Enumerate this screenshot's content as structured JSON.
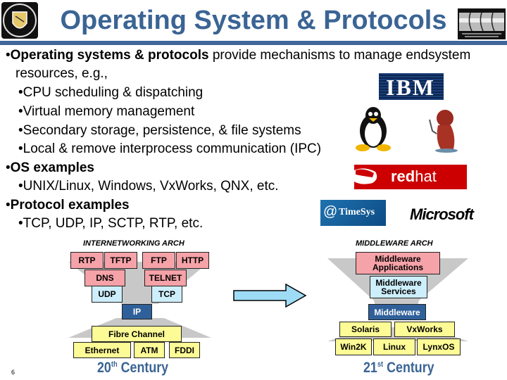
{
  "header": {
    "title": "Operating System & Protocols",
    "logo_left": "university-crest",
    "logo_right": "isis-logo"
  },
  "bullets": {
    "b1_bold": "Operating systems & protocols",
    "b1_rest": " provide mechanisms to manage endsystem",
    "b1_cont": "resources, e.g.,",
    "b1_items": [
      "CPU scheduling & dispatching",
      "Virtual memory management",
      "Secondary storage, persistence, & file systems",
      "Local & remove interprocess communication (IPC)"
    ],
    "b2_bold": "OS examples",
    "b2_items": [
      "UNIX/Linux, Windows, VxWorks, QNX, etc."
    ],
    "b3_bold": "Protocol examples",
    "b3_items": [
      "TCP, UDP, IP, SCTP, RTP, etc."
    ],
    "bullet_char": "•"
  },
  "logos": {
    "ibm": "IBM",
    "redhat_bold": "red",
    "redhat_rest": "hat",
    "timesys": "TimeSys",
    "microsoft": "Microsoft"
  },
  "diagram_left": {
    "caption": "INTERNETWORKING ARCH",
    "row1": [
      "RTP",
      "TFTP",
      "FTP",
      "HTTP"
    ],
    "row2": [
      "DNS",
      "TELNET"
    ],
    "row3": [
      "UDP",
      "TCP"
    ],
    "core": "IP",
    "row5": [
      "Fibre Channel"
    ],
    "row6": [
      "Ethernet",
      "ATM",
      "FDDI"
    ],
    "century_num": "20",
    "century_sup": "th",
    "century_word": " Century"
  },
  "diagram_right": {
    "caption": "MIDDLEWARE ARCH",
    "apps": "Middleware Applications",
    "services": "Middleware Services",
    "core": "Middleware",
    "row1": [
      "Solaris",
      "VxWorks"
    ],
    "row2": [
      "Win2K",
      "Linux",
      "LynxOS"
    ],
    "century_num": "21",
    "century_sup": "st",
    "century_word": " Century"
  },
  "footer": {
    "page_number": "6"
  },
  "colors": {
    "title": "#3a6494",
    "rule": "#41679a",
    "pink": "#f5a2a8",
    "cyan": "#cdeefb",
    "navy": "#30609a",
    "yellow": "#fdfb96",
    "arrow": "#9edcf5"
  }
}
